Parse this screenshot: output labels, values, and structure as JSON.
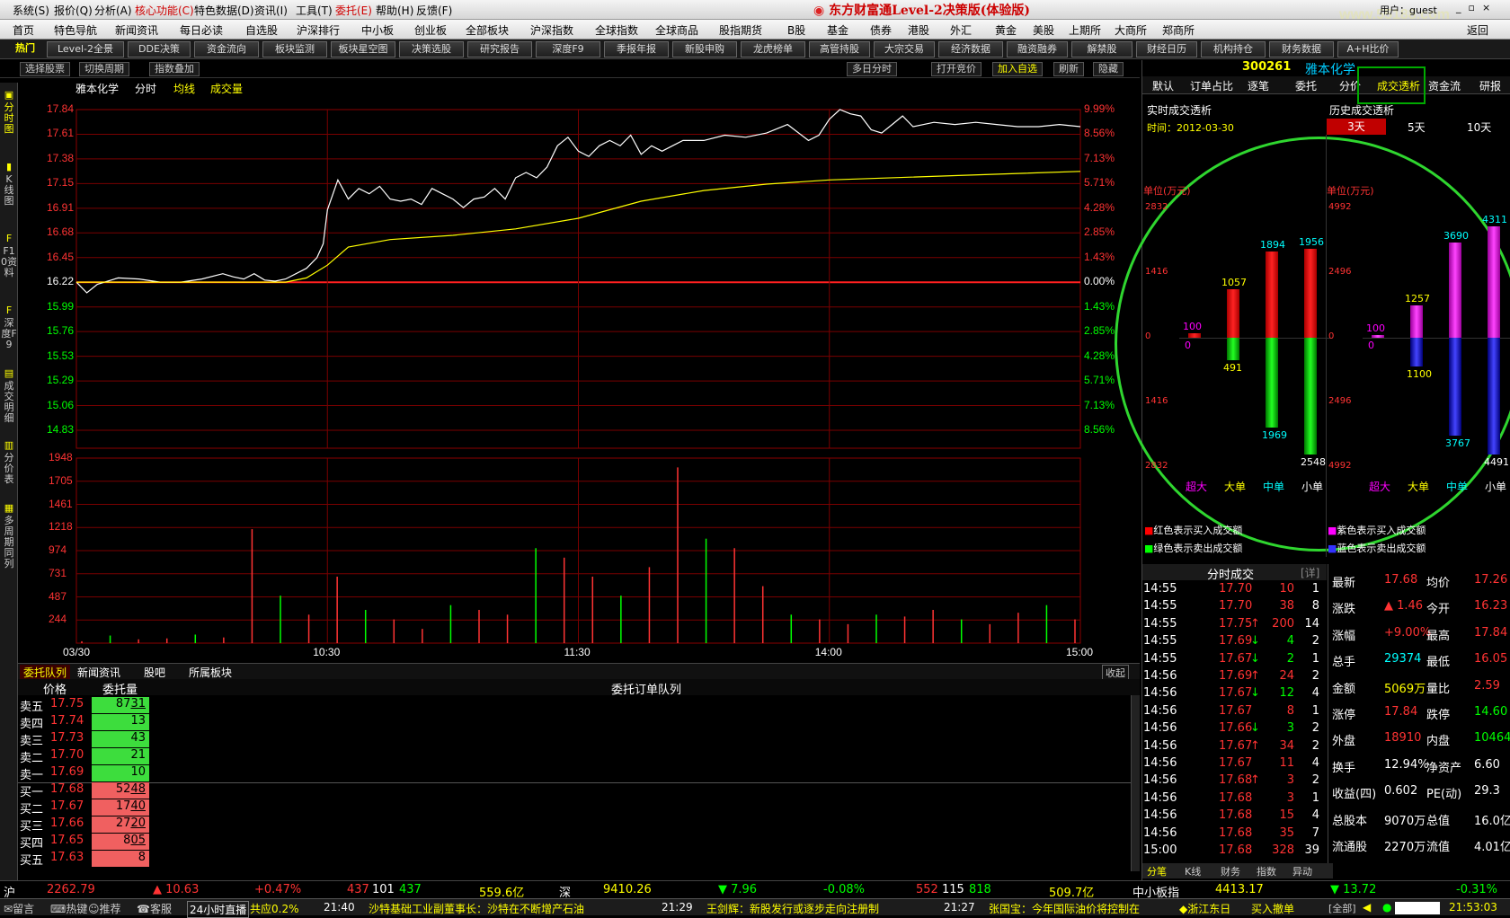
{
  "menu": [
    "系统(S)",
    "报价(Q)",
    "分析(A)",
    "核心功能(C)",
    "特色数据(D)",
    "资讯(I)",
    "工具(T)",
    "委托(E)",
    "帮助(H)",
    "反馈(F)"
  ],
  "app_title": "东方财富通Level-2决策版(体验版)",
  "user": "用户：guest",
  "watermark": "www.55188.com",
  "nav": [
    "首页",
    "特色导航",
    "新闻资讯",
    "每日必读",
    "自选股",
    "沪深排行",
    "中小板",
    "创业板",
    "全部板块",
    "沪深指数",
    "全球指数",
    "全球商品",
    "股指期货",
    "B股",
    "基金",
    "债券",
    "港股",
    "外汇",
    "黄金",
    "美股",
    "上期所",
    "大商所",
    "郑商所",
    "返回"
  ],
  "toolbar": [
    "热门",
    "Level-2全景",
    "DDE决策",
    "资金流向",
    "板块监测",
    "板块星空图",
    "决策选股",
    "研究报告",
    "深度F9",
    "季报年报",
    "新股申购",
    "龙虎榜单",
    "高管持股",
    "大宗交易",
    "经济数据",
    "融资融券",
    "解禁股",
    "财经日历",
    "机构持仓",
    "财务数据",
    "A+H比价"
  ],
  "subbar": {
    "left": [
      "选择股票",
      "切换周期",
      "指数叠加"
    ],
    "right": [
      "多日分时",
      "打开竞价",
      "加入自选",
      "刷新",
      "隐藏"
    ]
  },
  "leftnav": [
    "分时图",
    "K线图",
    "F10资料",
    "深度F9",
    "成交明细",
    "分价表",
    "多周期同列"
  ],
  "chart_header": {
    "name": "雅本化学",
    "period": "分时",
    "avg": "均线",
    "vol": "成交量"
  },
  "chart_data": {
    "type": "line",
    "prev_close": 16.22,
    "price_ticks": [
      "17.84",
      "17.61",
      "17.38",
      "17.15",
      "16.91",
      "16.68",
      "16.45",
      "16.22",
      "15.99",
      "15.76",
      "15.53",
      "15.29",
      "15.06",
      "14.83"
    ],
    "pct_ticks": [
      "9.99%",
      "8.56%",
      "7.13%",
      "5.71%",
      "4.28%",
      "2.85%",
      "1.43%",
      "0.00%",
      "1.43%",
      "2.85%",
      "4.28%",
      "5.71%",
      "7.13%",
      "8.56%"
    ],
    "vol_ticks": [
      "1948",
      "1705",
      "1461",
      "1218",
      "974",
      "731",
      "487",
      "244"
    ],
    "time_ticks": [
      "03/30",
      "10:30",
      "11:30",
      "14:00",
      "15:00"
    ],
    "price_series": [
      [
        0,
        16.22
      ],
      [
        5,
        16.12
      ],
      [
        10,
        16.2
      ],
      [
        20,
        16.26
      ],
      [
        30,
        16.25
      ],
      [
        40,
        16.22
      ],
      [
        50,
        16.22
      ],
      [
        60,
        16.25
      ],
      [
        70,
        16.3
      ],
      [
        75,
        16.27
      ],
      [
        80,
        16.25
      ],
      [
        85,
        16.3
      ],
      [
        90,
        16.24
      ],
      [
        95,
        16.23
      ],
      [
        100,
        16.25
      ],
      [
        110,
        16.35
      ],
      [
        115,
        16.45
      ],
      [
        118,
        16.58
      ],
      [
        120,
        16.9
      ],
      [
        125,
        17.18
      ],
      [
        130,
        17.0
      ],
      [
        135,
        17.1
      ],
      [
        140,
        17.05
      ],
      [
        145,
        17.12
      ],
      [
        150,
        17.0
      ],
      [
        155,
        16.98
      ],
      [
        160,
        17.0
      ],
      [
        165,
        16.95
      ],
      [
        170,
        17.1
      ],
      [
        175,
        17.05
      ],
      [
        180,
        17.0
      ],
      [
        185,
        16.92
      ],
      [
        190,
        17.0
      ],
      [
        195,
        17.02
      ],
      [
        200,
        17.1
      ],
      [
        205,
        17.0
      ],
      [
        210,
        17.2
      ],
      [
        215,
        17.25
      ],
      [
        220,
        17.2
      ],
      [
        225,
        17.3
      ],
      [
        230,
        17.5
      ],
      [
        235,
        17.58
      ],
      [
        240,
        17.45
      ],
      [
        245,
        17.4
      ],
      [
        250,
        17.5
      ],
      [
        255,
        17.55
      ],
      [
        260,
        17.5
      ],
      [
        265,
        17.6
      ],
      [
        270,
        17.42
      ],
      [
        275,
        17.5
      ],
      [
        280,
        17.45
      ],
      [
        285,
        17.5
      ],
      [
        290,
        17.55
      ],
      [
        300,
        17.55
      ],
      [
        310,
        17.6
      ],
      [
        320,
        17.58
      ],
      [
        330,
        17.62
      ],
      [
        340,
        17.7
      ],
      [
        350,
        17.55
      ],
      [
        355,
        17.6
      ],
      [
        360,
        17.75
      ],
      [
        365,
        17.84
      ],
      [
        370,
        17.8
      ],
      [
        375,
        17.78
      ],
      [
        380,
        17.65
      ],
      [
        385,
        17.62
      ],
      [
        390,
        17.7
      ],
      [
        395,
        17.78
      ],
      [
        400,
        17.68
      ],
      [
        410,
        17.72
      ],
      [
        420,
        17.7
      ],
      [
        430,
        17.72
      ],
      [
        440,
        17.7
      ],
      [
        450,
        17.68
      ],
      [
        460,
        17.68
      ],
      [
        470,
        17.7
      ],
      [
        480,
        17.68
      ]
    ],
    "avg_series": [
      [
        0,
        16.22
      ],
      [
        100,
        16.22
      ],
      [
        110,
        16.26
      ],
      [
        120,
        16.38
      ],
      [
        130,
        16.55
      ],
      [
        150,
        16.62
      ],
      [
        180,
        16.66
      ],
      [
        210,
        16.72
      ],
      [
        240,
        16.82
      ],
      [
        270,
        16.98
      ],
      [
        300,
        17.08
      ],
      [
        330,
        17.14
      ],
      [
        360,
        17.18
      ],
      [
        420,
        17.22
      ],
      [
        480,
        17.26
      ]
    ],
    "volume_bars": [
      20,
      80,
      40,
      50,
      90,
      60,
      1200,
      500,
      300,
      700,
      350,
      250,
      150,
      400,
      350,
      300,
      1000,
      900,
      700,
      500,
      800,
      1850,
      1100,
      1000,
      600,
      300,
      250,
      200,
      300,
      280,
      350,
      250,
      200,
      320,
      400,
      250
    ]
  },
  "right_panel": {
    "code": "300261",
    "name": "雅本化学",
    "tabs": [
      "默认",
      "订单占比",
      "逐笔",
      "委托",
      "分价",
      "成交透析",
      "资金流",
      "研报"
    ],
    "realtime_title": "实时成交透析",
    "time_label": "时间：2012-03-30",
    "history_title": "历史成交透析",
    "history_tabs": [
      "3天",
      "5天",
      "10天"
    ],
    "unit": "单位(万元)",
    "left_axis": [
      "2832",
      "1416",
      "0",
      "1416",
      "2832"
    ],
    "right_axis": [
      "4992",
      "2496",
      "0",
      "2496",
      "4992"
    ],
    "cats": [
      "超大",
      "大单",
      "中单",
      "小单"
    ],
    "rt_buy": [
      100,
      1057,
      1894,
      1956
    ],
    "rt_sell": [
      0,
      491,
      1969,
      2548
    ],
    "hist_buy": [
      100,
      1257,
      3690,
      4311
    ],
    "hist_sell": [
      0,
      1100,
      3767,
      4491
    ],
    "legend": [
      "红色表示买入成交额",
      "绿色表示卖出成交额",
      "紫色表示买入成交额",
      "蓝色表示卖出成交额"
    ],
    "trades_title": "分时成交",
    "trades_more": "[详]",
    "trades": [
      [
        "14:55",
        "17.70",
        "10",
        "1",
        "",
        ""
      ],
      [
        "14:55",
        "17.70",
        "38",
        "8",
        "",
        ""
      ],
      [
        "14:55",
        "17.75",
        "200",
        "14",
        "up",
        ""
      ],
      [
        "14:55",
        "17.69",
        "4",
        "2",
        "down",
        ""
      ],
      [
        "14:55",
        "17.67",
        "2",
        "1",
        "down",
        ""
      ],
      [
        "14:56",
        "17.69",
        "24",
        "2",
        "up",
        ""
      ],
      [
        "14:56",
        "17.67",
        "12",
        "4",
        "down",
        ""
      ],
      [
        "14:56",
        "17.67",
        "8",
        "1",
        "",
        ""
      ],
      [
        "14:56",
        "17.66",
        "3",
        "2",
        "down",
        ""
      ],
      [
        "14:56",
        "17.67",
        "34",
        "2",
        "up",
        ""
      ],
      [
        "14:56",
        "17.67",
        "11",
        "4",
        "",
        ""
      ],
      [
        "14:56",
        "17.68",
        "3",
        "2",
        "up",
        ""
      ],
      [
        "14:56",
        "17.68",
        "3",
        "1",
        "",
        ""
      ],
      [
        "14:56",
        "17.68",
        "15",
        "4",
        "",
        ""
      ],
      [
        "14:56",
        "17.68",
        "35",
        "7",
        "",
        ""
      ],
      [
        "15:00",
        "17.68",
        "328",
        "39",
        "",
        ""
      ]
    ],
    "quote": [
      [
        "最新",
        "17.68",
        "均价",
        "17.26"
      ],
      [
        "涨跌",
        "▲ 1.46",
        "今开",
        "16.23"
      ],
      [
        "涨幅",
        "+9.00%",
        "最高",
        "17.84"
      ],
      [
        "总手",
        "29374",
        "最低",
        "16.05"
      ],
      [
        "金额",
        "5069万",
        "量比",
        "2.59"
      ],
      [
        "涨停",
        "17.84",
        "跌停",
        "14.60"
      ],
      [
        "外盘",
        "18910",
        "内盘",
        "10464"
      ],
      [
        "换手",
        "12.94%",
        "净资产",
        "6.60"
      ],
      [
        "收益(四)",
        "0.602",
        "PE(动)",
        "29.3"
      ],
      [
        "总股本",
        "9070万",
        "总值",
        "16.0亿"
      ],
      [
        "流通股",
        "2270万",
        "流值",
        "4.01亿"
      ]
    ],
    "bottom_tabs": [
      "分笔",
      "K线",
      "财务",
      "指数",
      "异动"
    ]
  },
  "order_queue": {
    "tabs": [
      "委托队列",
      "新闻资讯",
      "股吧",
      "所属板块"
    ],
    "collapse": "收起",
    "col_price": "价格",
    "col_vol": "委托量",
    "col_queue": "委托订单队列",
    "rows": [
      [
        "卖五",
        "17.75",
        "87",
        "31"
      ],
      [
        "卖四",
        "17.74",
        "13",
        ""
      ],
      [
        "卖三",
        "17.73",
        "43",
        ""
      ],
      [
        "卖二",
        "17.70",
        "21",
        ""
      ],
      [
        "卖一",
        "17.69",
        "10",
        ""
      ],
      [
        "买一",
        "17.68",
        "52",
        "48"
      ],
      [
        "买二",
        "17.67",
        "17",
        "40"
      ],
      [
        "买三",
        "17.66",
        "27",
        "20"
      ],
      [
        "买四",
        "17.65",
        "8",
        "05"
      ],
      [
        "买五",
        "17.63",
        "8",
        ""
      ]
    ]
  },
  "index_bar": {
    "sh": [
      "沪",
      "2262.79",
      "▲ 10.63",
      "+0.47%",
      "437",
      "101",
      "437",
      "559.6亿"
    ],
    "sz": [
      "深",
      "9410.26",
      "▼ 7.96",
      "-0.08%",
      "552",
      "115",
      "818",
      "509.7亿"
    ],
    "sme": [
      "中小板指",
      "4413.17",
      "▼ 13.72",
      "-0.31%"
    ]
  },
  "status_bar": [
    "留言",
    "热键",
    "推荐",
    "客服",
    "24小时直播",
    "共应0.2%",
    "21:40",
    "沙特基础工业副董事长：沙特在不断增产石油",
    "21:29",
    "王剑辉：新股发行或逐步走向注册制",
    "21:27",
    "张国宝：今年国际油价将控制在",
    "浙江东日",
    "买入撤单",
    "[全部]",
    "21:53:03"
  ]
}
